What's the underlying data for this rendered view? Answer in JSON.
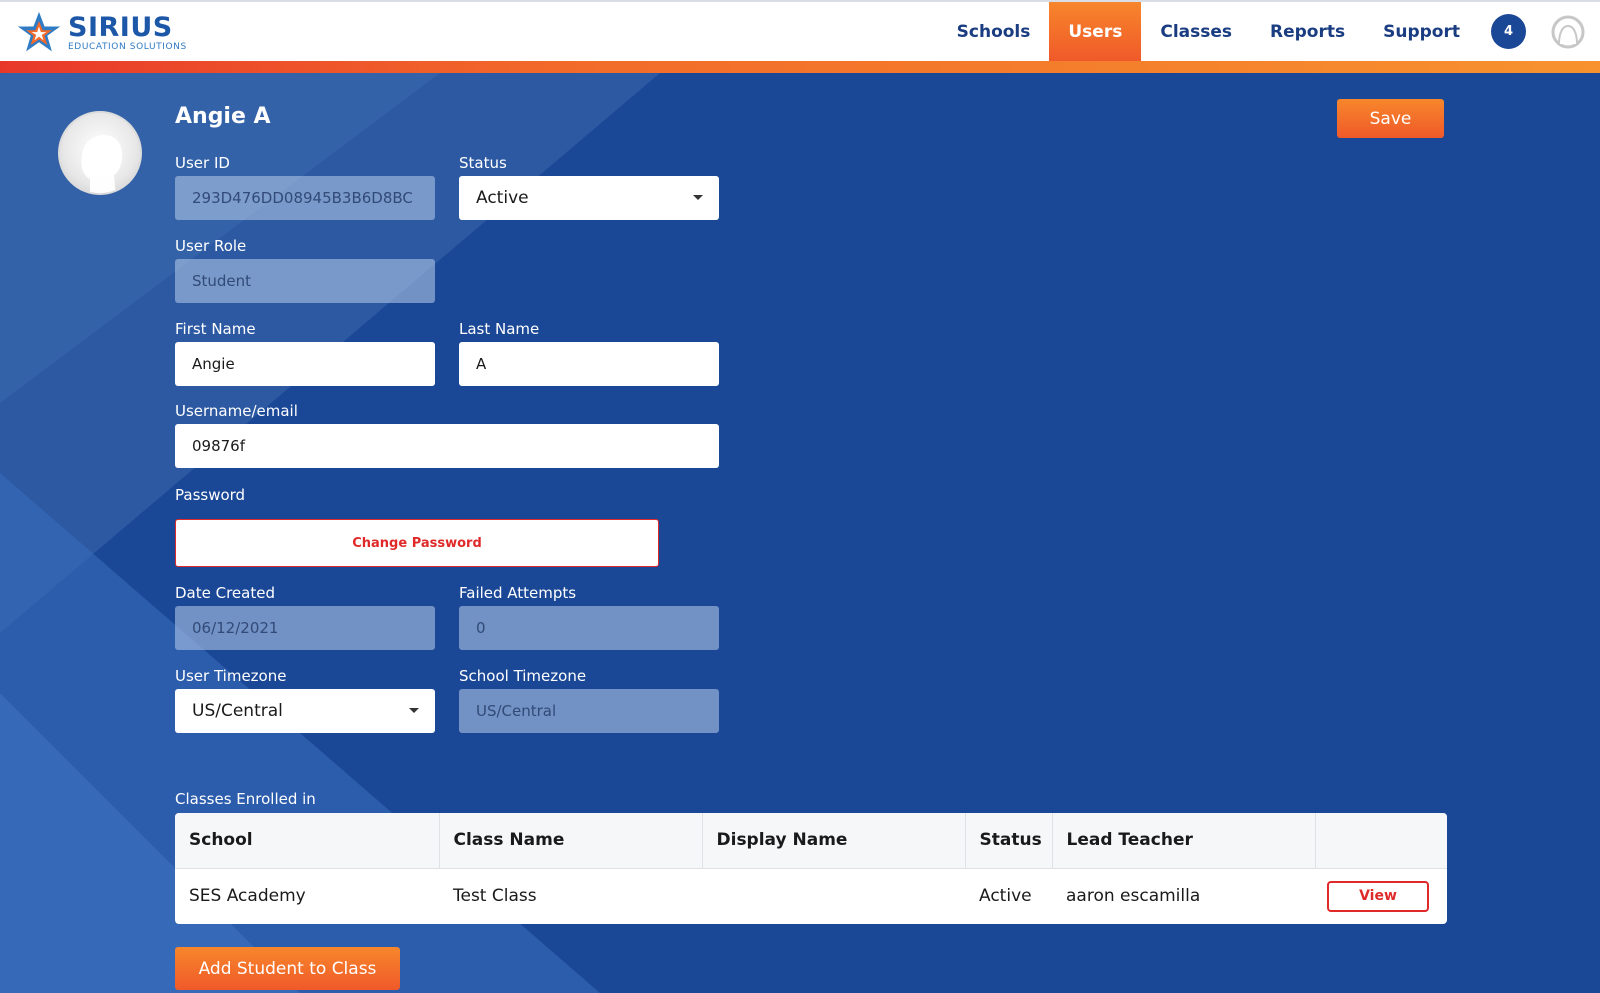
{
  "brand": {
    "title": "SIRIUS",
    "subtitle": "EDUCATION SOLUTIONS"
  },
  "nav": {
    "items": [
      "Schools",
      "Users",
      "Classes",
      "Reports",
      "Support"
    ],
    "active": "Users",
    "notification_count": "4"
  },
  "profile": {
    "name": "Angie A",
    "save_label": "Save"
  },
  "form": {
    "user_id": {
      "label": "User ID",
      "value": "293D476DD08945B3B6D8BC"
    },
    "status": {
      "label": "Status",
      "value": "Active"
    },
    "user_role": {
      "label": "User Role",
      "value": "Student"
    },
    "first_name": {
      "label": "First Name",
      "value": "Angie"
    },
    "last_name": {
      "label": "Last Name",
      "value": "A"
    },
    "username": {
      "label": "Username/email",
      "value": "09876f"
    },
    "password": {
      "label": "Password",
      "button": "Change Password"
    },
    "date_created": {
      "label": "Date Created",
      "value": "06/12/2021"
    },
    "failed_attempts": {
      "label": "Failed Attempts",
      "value": "0"
    },
    "user_timezone": {
      "label": "User Timezone",
      "value": "US/Central"
    },
    "school_timezone": {
      "label": "School Timezone",
      "value": "US/Central"
    }
  },
  "classes": {
    "title": "Classes Enrolled in",
    "columns": [
      "School",
      "Class Name",
      "Display Name",
      "Status",
      "Lead Teacher",
      ""
    ],
    "rows": [
      {
        "school": "SES Academy",
        "class_name": "Test Class",
        "display_name": "",
        "status": "Active",
        "lead_teacher": "aaron escamilla",
        "action": "View"
      }
    ],
    "add_label": "Add Student to Class"
  },
  "colors": {
    "background": "#1b4896",
    "accent": "#f26a2a",
    "nav_text": "#1a3d82",
    "danger": "#e02a2a"
  }
}
